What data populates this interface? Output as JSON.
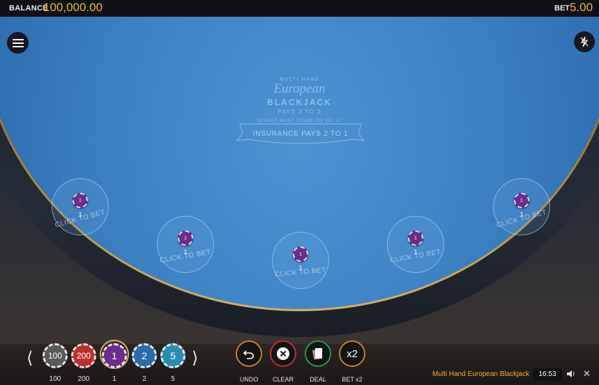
{
  "header": {
    "balance_label": "BALANCE",
    "balance_value": "100,000.00",
    "bet_label": "BET",
    "bet_value": "5.00"
  },
  "table": {
    "logo_multi": "MULTI HAND",
    "logo_european": "European",
    "logo_blackjack": "BLACKJACK",
    "logo_pays": "PAYS 3 TO 2",
    "logo_dealer_rule": "DEALER MUST STAND ON ALL 17",
    "insurance_banner": "INSURANCE PAYS 2 TO 1",
    "spots": [
      {
        "label": "CLICK TO BET",
        "chip_value": "1",
        "amount": "1"
      },
      {
        "label": "CLICK TO BET",
        "chip_value": "1",
        "amount": "1"
      },
      {
        "label": "CLICK TO BET",
        "chip_value": "1",
        "amount": "1"
      },
      {
        "label": "CLICK TO BET",
        "chip_value": "1",
        "amount": "1"
      },
      {
        "label": "CLICK TO BET",
        "chip_value": "1",
        "amount": "1"
      }
    ]
  },
  "chips": [
    {
      "value": "100",
      "label": "100",
      "color": "#5a5a5a"
    },
    {
      "value": "200",
      "label": "200",
      "color": "#b8312f"
    },
    {
      "value": "1",
      "label": "1",
      "color": "#6c2c8a",
      "selected": true
    },
    {
      "value": "2",
      "label": "2",
      "color": "#2d6aa8"
    },
    {
      "value": "5",
      "label": "5",
      "color": "#2d8cab"
    }
  ],
  "actions": [
    {
      "label": "UNDO",
      "icon": "undo-icon"
    },
    {
      "label": "CLEAR",
      "icon": "clear-icon"
    },
    {
      "label": "DEAL",
      "icon": "deal-cards-icon"
    },
    {
      "label": "BET x2",
      "icon_text": "x2"
    }
  ],
  "footer": {
    "game_name": "Multi Hand European Blackjack",
    "clock": "16:53"
  },
  "icons": {
    "menu": "menu-icon",
    "turbo": "turbo-off-icon",
    "prev": "chevron-left-icon",
    "next": "chevron-right-icon",
    "sound": "speaker-icon",
    "close": "close-icon"
  },
  "colors": {
    "accent": "#f2b233",
    "felt": "#3f84c6",
    "rail_gold": "#c9a54c"
  }
}
